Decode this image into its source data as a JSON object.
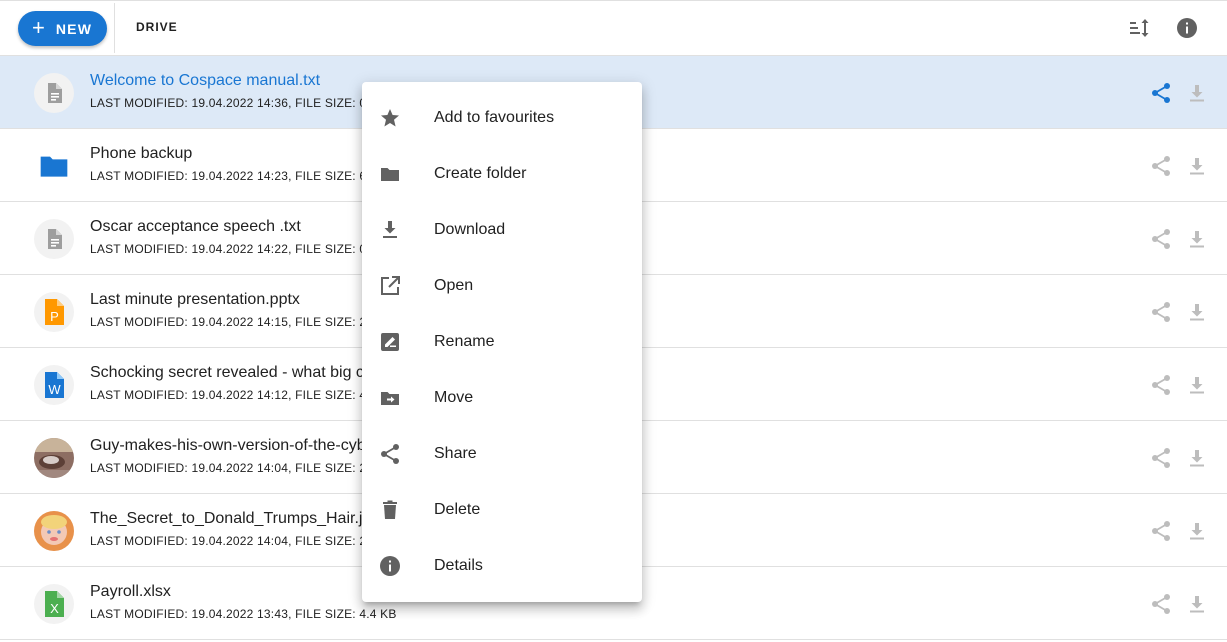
{
  "toolbar": {
    "new_label": "NEW",
    "new_icon": "plus-icon",
    "section_label": "DRIVE",
    "sort_icon": "sort-icon",
    "info_icon": "info-icon",
    "accent": "#1976d2"
  },
  "files": [
    {
      "name": "Welcome to Cospace manual.txt",
      "meta": "LAST MODIFIED: 19.04.2022 14:36, FILE SIZE: 0",
      "icon": "text-file-icon",
      "selected": true
    },
    {
      "name": "Phone backup",
      "meta": "LAST MODIFIED: 19.04.2022 14:23, FILE SIZE: 6",
      "icon": "folder-icon"
    },
    {
      "name": "Oscar acceptance speech .txt",
      "meta": "LAST MODIFIED: 19.04.2022 14:22, FILE SIZE: 0",
      "icon": "text-file-icon"
    },
    {
      "name": "Last minute presentation.pptx",
      "meta": "LAST MODIFIED: 19.04.2022 14:15, FILE SIZE: 2",
      "icon": "powerpoint-file-icon"
    },
    {
      "name": "Schocking secret revealed - what big c",
      "meta": "LAST MODIFIED: 19.04.2022 14:12, FILE SIZE: 4",
      "icon": "word-file-icon"
    },
    {
      "name": "Guy-makes-his-own-version-of-the-cybe",
      "meta": "LAST MODIFIED: 19.04.2022 14:04, FILE SIZE: 2",
      "icon": "image-thumbnail"
    },
    {
      "name": "The_Secret_to_Donald_Trumps_Hair.jp",
      "meta": "LAST MODIFIED: 19.04.2022 14:04, FILE SIZE: 2",
      "icon": "image-thumbnail"
    },
    {
      "name": "Payroll.xlsx",
      "meta": "LAST MODIFIED: 19.04.2022 13:43, FILE SIZE: 4.4 KB",
      "icon": "excel-file-icon"
    }
  ],
  "context_menu": [
    {
      "label": "Add to favourites",
      "icon": "star-icon"
    },
    {
      "label": "Create folder",
      "icon": "folder-icon"
    },
    {
      "label": "Download",
      "icon": "download-icon"
    },
    {
      "label": "Open",
      "icon": "open-in-new-icon"
    },
    {
      "label": "Rename",
      "icon": "rename-icon"
    },
    {
      "label": "Move",
      "icon": "move-folder-icon"
    },
    {
      "label": "Share",
      "icon": "share-icon"
    },
    {
      "label": "Delete",
      "icon": "delete-icon"
    },
    {
      "label": "Details",
      "icon": "info-icon"
    }
  ]
}
